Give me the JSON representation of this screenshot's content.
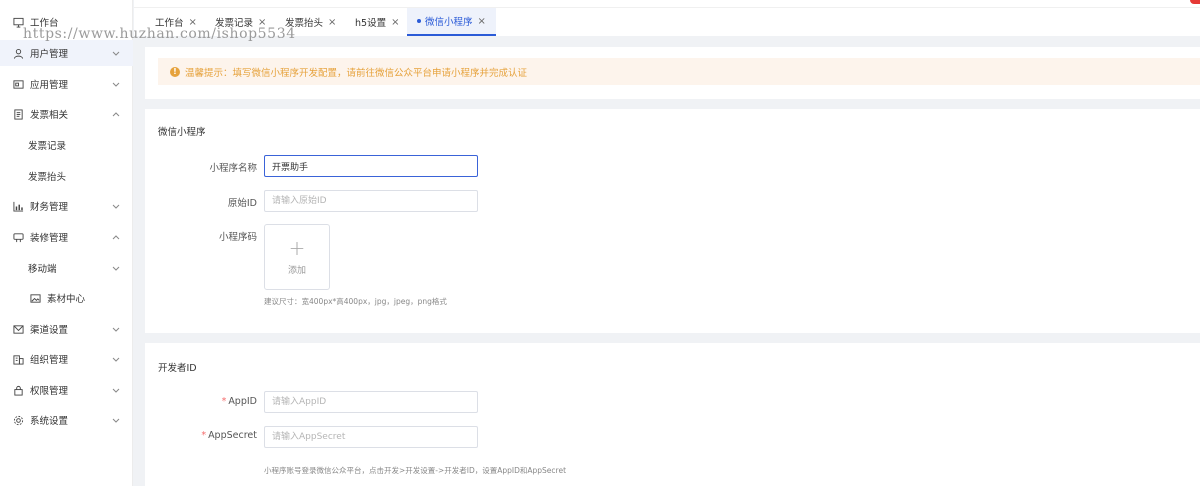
{
  "sidebar": {
    "items": [
      {
        "label": "工作台",
        "icon": "monitor-icon"
      },
      {
        "label": "用户管理",
        "icon": "user-icon"
      },
      {
        "label": "应用管理",
        "icon": "app-icon"
      },
      {
        "label": "发票相关",
        "icon": "invoice-icon"
      },
      {
        "label": "发票记录"
      },
      {
        "label": "发票抬头"
      },
      {
        "label": "财务管理",
        "icon": "finance-icon"
      },
      {
        "label": "装修管理",
        "icon": "decor-icon"
      },
      {
        "label": "移动端"
      },
      {
        "label": "素材中心",
        "icon": "image-icon"
      },
      {
        "label": "渠道设置",
        "icon": "channel-icon"
      },
      {
        "label": "组织管理",
        "icon": "org-icon"
      },
      {
        "label": "权限管理",
        "icon": "lock-icon"
      },
      {
        "label": "系统设置",
        "icon": "settings-icon"
      }
    ]
  },
  "watermark": "https://www.huzhan.com/ishop5534",
  "tabs": [
    {
      "label": "工作台"
    },
    {
      "label": "发票记录"
    },
    {
      "label": "发票抬头"
    },
    {
      "label": "h5设置"
    },
    {
      "label": "微信小程序"
    }
  ],
  "alert": {
    "text": "温馨提示：填写微信小程序开发配置，请前往微信公众平台申请小程序并完成认证"
  },
  "miniapp": {
    "title": "微信小程序",
    "name_label": "小程序名称",
    "name_value": "开票助手",
    "origin_label": "原始ID",
    "origin_placeholder": "请输入原始ID",
    "code_label": "小程序码",
    "upload_label": "添加",
    "upload_hint": "建议尺寸：宽400px*高400px，jpg，jpeg，png格式"
  },
  "developer": {
    "title": "开发者ID",
    "appid_label": "AppID",
    "appid_placeholder": "请输入AppID",
    "secret_label": "AppSecret",
    "secret_placeholder": "请输入AppSecret",
    "hint": "小程序账号登录微信公众平台，点击开发>开发设置->开发者ID，设置AppID和AppSecret"
  },
  "colors": {
    "accent": "#2b5bd7",
    "warning": "#e6a23c",
    "required": "#f56c6c"
  }
}
